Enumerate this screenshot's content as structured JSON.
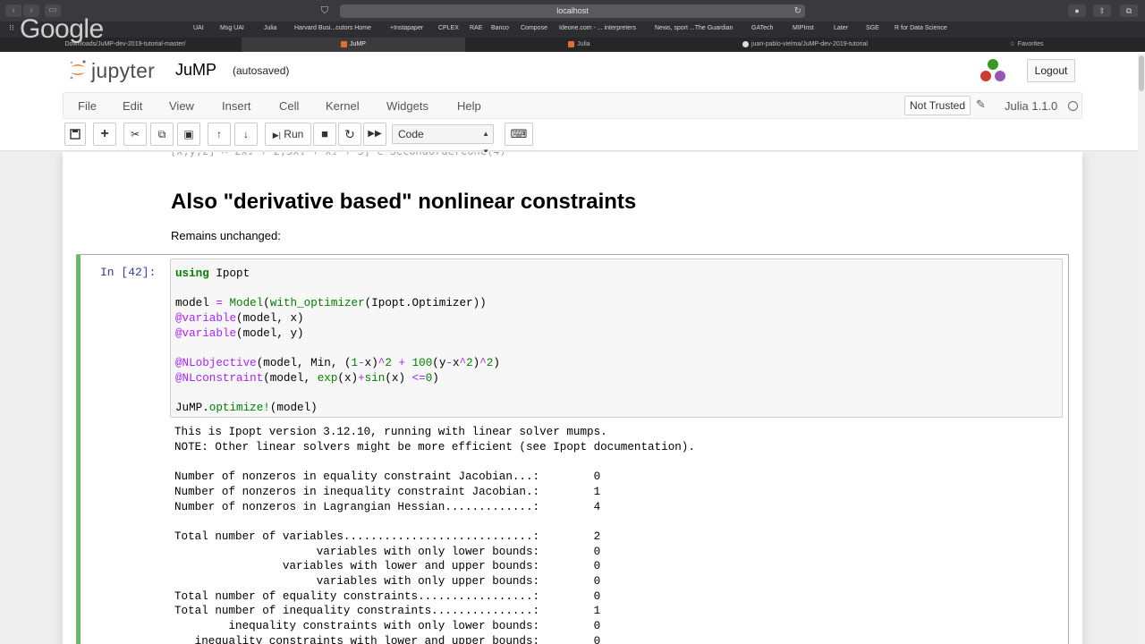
{
  "browser": {
    "address": "localhost",
    "bookmarks": [
      "UAI",
      "Msg UAI",
      "Julia",
      "Harvard Busi...cutors Home",
      "+Instapaper",
      "CPLEX",
      "RAE",
      "Banco",
      "Compose",
      "Ideone.com - ... interpreters",
      "News, sport ...The Guardian",
      "GATech",
      "MIPInst",
      "Later",
      "SGE",
      "R for Data Science"
    ],
    "tabs": [
      "Downloads/JuMP-dev-2019-tutorial-master/",
      "JuMP",
      "Julia",
      "juan-pablo-vielma/JuMP-dev-2019-tutorial",
      "Favorites"
    ],
    "overlay_logo": "Google"
  },
  "header": {
    "logo_text": "jupyter",
    "notebook_title": "JuMP",
    "autosave": "(autosaved)",
    "logout": "Logout"
  },
  "menubar": {
    "items": [
      "File",
      "Edit",
      "View",
      "Insert",
      "Cell",
      "Kernel",
      "Widgets",
      "Help"
    ],
    "not_trusted": "Not Trusted",
    "kernel": "Julia 1.1.0"
  },
  "toolbar": {
    "run_label": "Run",
    "cell_type": "Code"
  },
  "notebook": {
    "heading": "Also \"derivative based\" nonlinear constraints",
    "paragraph": "Remains unchanged:",
    "prompt": "In [42]:",
    "output_lines": [
      "This is Ipopt version 3.12.10, running with linear solver mumps.",
      "NOTE: Other linear solvers might be more efficient (see Ipopt documentation).",
      "",
      "Number of nonzeros in equality constraint Jacobian...:        0",
      "Number of nonzeros in inequality constraint Jacobian.:        1",
      "Number of nonzeros in Lagrangian Hessian.............:        4",
      "",
      "Total number of variables............................:        2",
      "                     variables with only lower bounds:        0",
      "                variables with lower and upper bounds:        0",
      "                     variables with only upper bounds:        0",
      "Total number of equality constraints.................:        0",
      "Total number of inequality constraints...............:        1",
      "        inequality constraints with only lower bounds:        0",
      "   inequality constraints with lower and upper bounds:        0"
    ]
  },
  "colors": {
    "cell_border": "#66bb6a",
    "prompt": "#303f9f",
    "keyword": "#008000",
    "macro": "#aa22ff"
  }
}
